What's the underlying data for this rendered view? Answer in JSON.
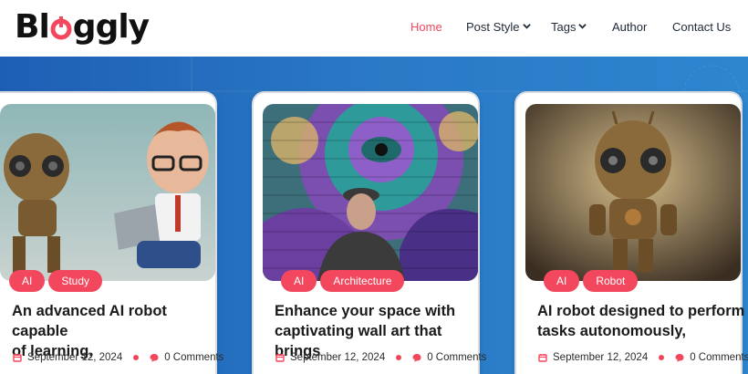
{
  "brand": {
    "logo_pre": "B",
    "logo_o": "l",
    "logo_post": "ggly",
    "accent": "#f3475d"
  },
  "nav": {
    "home": "Home",
    "post_style": "Post Style",
    "tags": "Tags",
    "author": "Author",
    "contact": "Contact Us"
  },
  "posts": [
    {
      "tags": [
        "AI",
        "Study"
      ],
      "title_line1": "An advanced AI robot capable",
      "title_line2": "of learning,",
      "date": "September 12, 2024",
      "comments": "0 Comments"
    },
    {
      "tags": [
        "AI",
        "Architecture"
      ],
      "title_line1": "Enhance your space with",
      "title_line2": "captivating wall art that brings",
      "date": "September 12, 2024",
      "comments": "0 Comments"
    },
    {
      "tags": [
        "AI",
        "Robot"
      ],
      "title_line1": "AI robot designed to perform",
      "title_line2": "tasks autonomously,",
      "date": "September 12, 2024",
      "comments": "0 Comments"
    }
  ]
}
